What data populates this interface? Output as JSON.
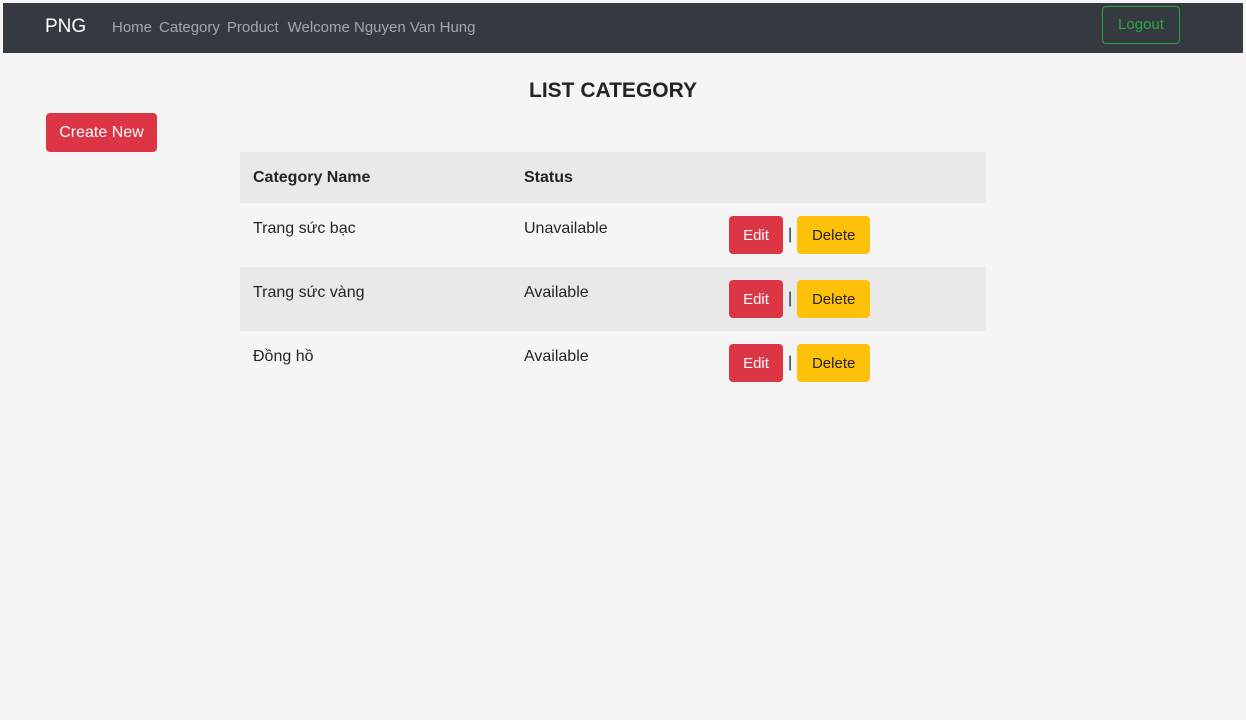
{
  "navbar": {
    "brand": "PNG",
    "links": [
      {
        "label": "Home"
      },
      {
        "label": "Category"
      },
      {
        "label": "Product"
      }
    ],
    "welcome": "Welcome Nguyen Van Hung",
    "logout_label": "Logout"
  },
  "page": {
    "title": "LIST CATEGORY",
    "create_label": "Create New"
  },
  "table": {
    "headers": {
      "name": "Category Name",
      "status": "Status"
    },
    "rows": [
      {
        "name": "Trang sức bạc",
        "status": "Unavailable",
        "edit": "Edit",
        "sep": "|",
        "delete": "Delete"
      },
      {
        "name": "Trang sức vàng",
        "status": "Available",
        "edit": "Edit",
        "sep": "|",
        "delete": "Delete"
      },
      {
        "name": "Đồng hồ",
        "status": "Available",
        "edit": "Edit",
        "sep": "|",
        "delete": "Delete"
      }
    ]
  },
  "colors": {
    "navbar_bg": "#343a40",
    "danger": "#dc3545",
    "warning": "#ffc107",
    "success": "#28a745",
    "page_bg": "#f5f5f5"
  }
}
